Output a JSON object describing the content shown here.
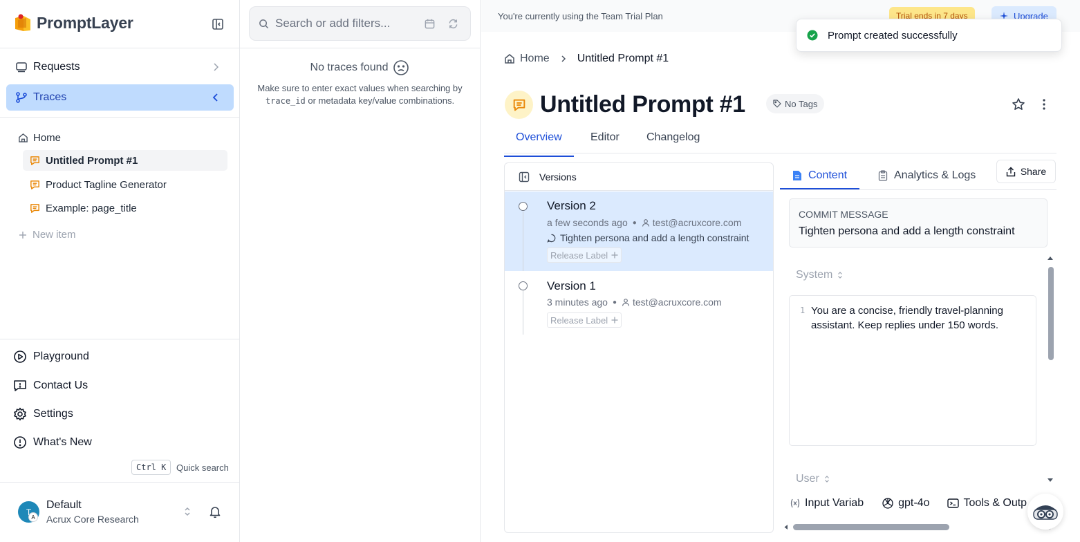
{
  "app": {
    "name": "PromptLayer"
  },
  "sidebar": {
    "nav": [
      {
        "label": "Requests"
      },
      {
        "label": "Traces"
      }
    ],
    "tree": {
      "home": "Home",
      "items": [
        {
          "label": "Untitled Prompt #1"
        },
        {
          "label": "Product Tagline Generator"
        },
        {
          "label": "Example: page_title"
        }
      ],
      "new_item": "New item"
    },
    "bottom": [
      {
        "label": "Playground"
      },
      {
        "label": "Contact Us"
      },
      {
        "label": "Settings"
      },
      {
        "label": "What's New"
      }
    ],
    "shortcut": {
      "key": "Ctrl K",
      "label": "Quick search"
    },
    "workspace": {
      "avatar": "T",
      "avatar_sub": "A",
      "name": "Default",
      "org": "Acrux Core Research"
    }
  },
  "traces": {
    "search_placeholder": "Search or add filters...",
    "empty_title": "No traces found",
    "empty_desc_1": "Make sure to enter exact values when searching by",
    "empty_code": "trace_id",
    "empty_desc_2": "or metadata key/value combinations."
  },
  "banner": {
    "text": "You're currently using the Team Trial Plan",
    "trial": "Trial ends in 7 days",
    "upgrade": "Upgrade"
  },
  "toast": {
    "text": "Prompt created successfully"
  },
  "breadcrumb": {
    "home": "Home",
    "current": "Untitled Prompt #1"
  },
  "prompt": {
    "title": "Untitled Prompt #1",
    "tags": "No Tags",
    "tabs": [
      {
        "label": "Overview"
      },
      {
        "label": "Editor"
      },
      {
        "label": "Changelog"
      }
    ]
  },
  "versions": {
    "header": "Versions",
    "items": [
      {
        "name": "Version 2",
        "time": "a few seconds ago",
        "author": "test@acruxcore.com",
        "commit": "Tighten persona and add a length constraint",
        "release_label": "Release Label"
      },
      {
        "name": "Version 1",
        "time": "3 minutes ago",
        "author": "test@acruxcore.com",
        "commit": "",
        "release_label": "Release Label"
      }
    ]
  },
  "content": {
    "tabs": [
      {
        "label": "Content"
      },
      {
        "label": "Analytics & Logs"
      }
    ],
    "share": "Share",
    "commit_label": "COMMIT MESSAGE",
    "commit_text": "Tighten persona and add a length constraint",
    "system_role": "System",
    "line_number": "1",
    "system_text": "You are a concise, friendly travel-planning assistant. Keep replies under 150 words.",
    "user_role": "User",
    "bottom_bar": [
      {
        "label": "Input Variab"
      },
      {
        "label": "gpt-4o"
      },
      {
        "label": "Tools & Outp"
      }
    ]
  },
  "colors": {
    "accent": "#1d4ed8",
    "active_nav_bg": "#bfdbfe",
    "selected_row_bg": "#dbeafe",
    "prompt_icon": "#ea8a0c",
    "success": "#16a34a"
  }
}
